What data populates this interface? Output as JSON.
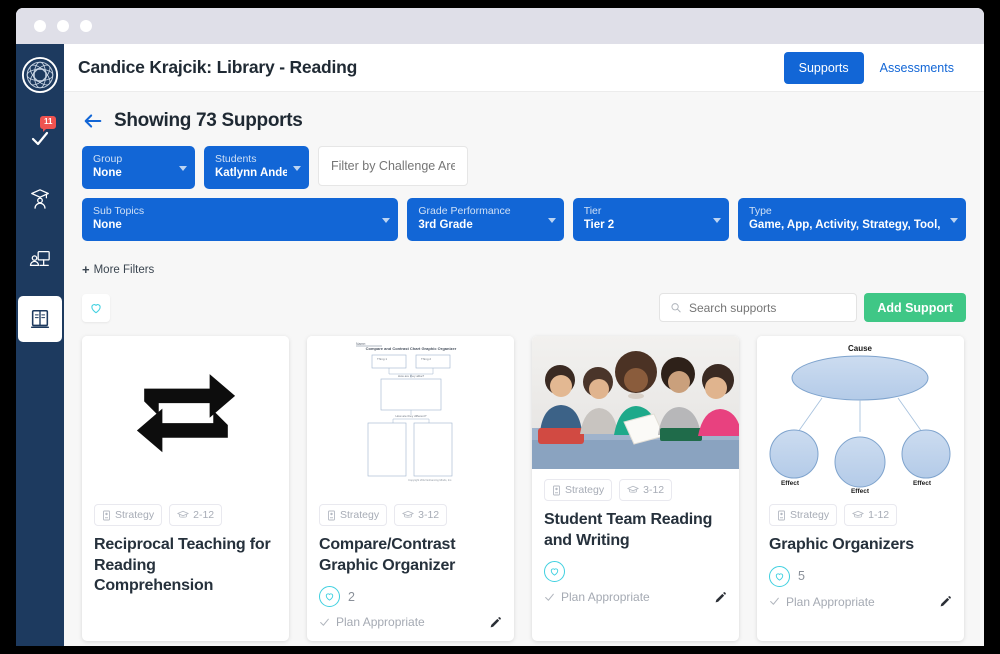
{
  "window": {
    "dots": 3
  },
  "sidebar": {
    "logo_name": "app-logo",
    "items": [
      {
        "id": "tasks",
        "icon": "check-icon",
        "badge": "11",
        "active": false
      },
      {
        "id": "students",
        "icon": "graduation-student-icon",
        "badge": "",
        "active": false
      },
      {
        "id": "classroom",
        "icon": "person-screen-icon",
        "badge": "",
        "active": false
      },
      {
        "id": "library",
        "icon": "book-icon",
        "badge": "",
        "active": true
      }
    ]
  },
  "header": {
    "title": "Candice Krajcik: Library - Reading",
    "supports_tab": "Supports",
    "assessments_tab": "Assessments"
  },
  "subheader": {
    "back_icon": "back-arrow-icon",
    "showing": "Showing 73 Supports"
  },
  "filters": {
    "row1": [
      {
        "label": "Group",
        "value": "None"
      },
      {
        "label": "Students",
        "value": "Katlynn Anders..."
      }
    ],
    "challenge_placeholder": "Filter by Challenge Areas",
    "challenge_value": "",
    "row2": [
      {
        "label": "Sub Topics",
        "value": "None"
      },
      {
        "label": "Grade Performance",
        "value": "3rd Grade"
      },
      {
        "label": "Tier",
        "value": "Tier 2"
      },
      {
        "label": "Type",
        "value": "Game, App, Activity, Strategy, Tool, Progr..."
      }
    ],
    "more_filters": "More Filters",
    "more_filters_plus": "+"
  },
  "toolbar": {
    "favorites_icon": "heart-outline-icon",
    "search_placeholder": "Search supports",
    "search_value": "",
    "search_icon": "search-icon",
    "add_label": "Add Support"
  },
  "cards": [
    {
      "thumb": "repeat-arrows-icon",
      "type_chip": "Strategy",
      "type_icon": "strategy-icon",
      "grade_chip": "2-12",
      "grade_icon": "graduation-cap-icon",
      "title": "Reciprocal Teaching for Reading Comprehension",
      "fav_count": "",
      "plan_text": "",
      "plan_icon": ""
    },
    {
      "thumb": "worksheet-graphic-organizer",
      "thumb_title": "Compare and Contrast Chart Graphic Organizer",
      "thumb_name_label": "Name:",
      "thumb_box1": "Thing 1",
      "thumb_box2": "Thing 2",
      "thumb_mid_label": "How are they alike?",
      "thumb_lower_label": "How are they different?",
      "thumb_footer": "Copyright 2012 Enhancing Minds, Inc.",
      "type_chip": "Strategy",
      "type_icon": "strategy-icon",
      "grade_chip": "3-12",
      "grade_icon": "graduation-cap-icon",
      "title": "Compare/Contrast Graphic Organizer",
      "fav_count": "2",
      "plan_text": "Plan Appropriate",
      "plan_icon": "check-icon"
    },
    {
      "thumb": "students-reading-photo",
      "type_chip": "Strategy",
      "type_icon": "strategy-icon",
      "grade_chip": "3-12",
      "grade_icon": "graduation-cap-icon",
      "title": "Student Team Reading and Writing",
      "fav_count": "",
      "plan_text": "Plan Appropriate",
      "plan_icon": "check-icon"
    },
    {
      "thumb": "cause-effect-diagram",
      "thumb_cause": "Cause",
      "thumb_effect": "Effect",
      "type_chip": "Strategy",
      "type_icon": "strategy-icon",
      "grade_chip": "1-12",
      "grade_icon": "graduation-cap-icon",
      "title": "Graphic Organizers",
      "fav_count": "5",
      "plan_text": "Plan Appropriate",
      "plan_icon": "check-icon"
    }
  ],
  "colors": {
    "accent_blue": "#1266d6",
    "sidebar_navy": "#1d3a5f",
    "green": "#3fc786",
    "cyan": "#3fd0e0",
    "badge_red": "#ef5350"
  }
}
